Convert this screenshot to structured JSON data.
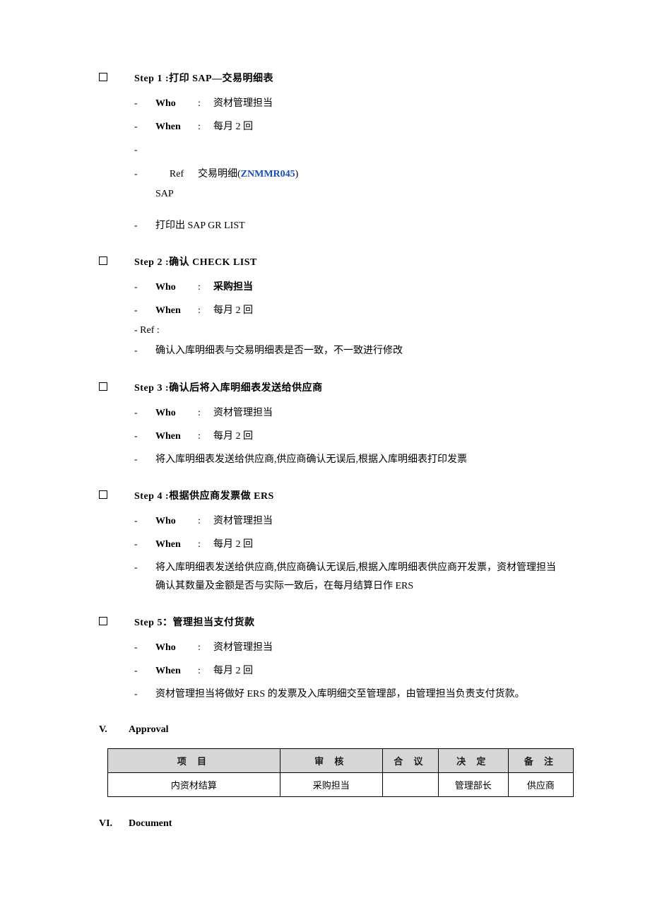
{
  "steps": [
    {
      "title": "Step 1 :打印 SAP—交易明细表",
      "who": "资材管理担当",
      "when": "每月 2 回",
      "ref_lbl": "Ref",
      "ref_sub": "SAP",
      "ref_val_pre": "交易明细(",
      "ref_code": "ZNMMR045",
      "ref_val_suf": ")",
      "note": "打印出 SAP  GR  LIST"
    },
    {
      "title": "Step 2 :确认 CHECK LIST",
      "who": "采购担当",
      "when": "每月 2 回",
      "ref_inline": "- Ref          :",
      "note": "确认入库明细表与交易明细表是否一致，不一致进行修改"
    },
    {
      "title": "Step 3 :确认后将入库明细表发送给供应商",
      "who": "资材管理担当",
      "when": "每月 2 回",
      "note": "将入库明细表发送给供应商,供应商确认无误后,根据入库明细表打印发票"
    },
    {
      "title": "Step 4 :根据供应商发票做 ERS",
      "who": "资材管理担当",
      "when": "每月 2 回",
      "note": "将入库明细表发送给供应商,供应商确认无误后,根据入库明细表供应商开发票，资材管理担当确认其数量及金额是否与实际一致后，在每月结算日作 ERS"
    },
    {
      "title": "Step 5：管理担当支付货款",
      "who": "资材管理担当",
      "when": "每月 2 回",
      "note": "资材管理担当将做好 ERS 的发票及入库明细交至管理部，由管理担当负责支付货款。"
    }
  ],
  "labels": {
    "who": "Who",
    "when": "When"
  },
  "sections": {
    "v_num": "V.",
    "v_title": "Approval",
    "vi_num": "VI.",
    "vi_title": "Document"
  },
  "approval": {
    "headers": [
      "项  目",
      "审  核",
      "合  议",
      "决  定",
      "备  注"
    ],
    "row": [
      "内资材结算",
      "采购担当",
      "",
      "管理部长",
      "供应商"
    ]
  }
}
